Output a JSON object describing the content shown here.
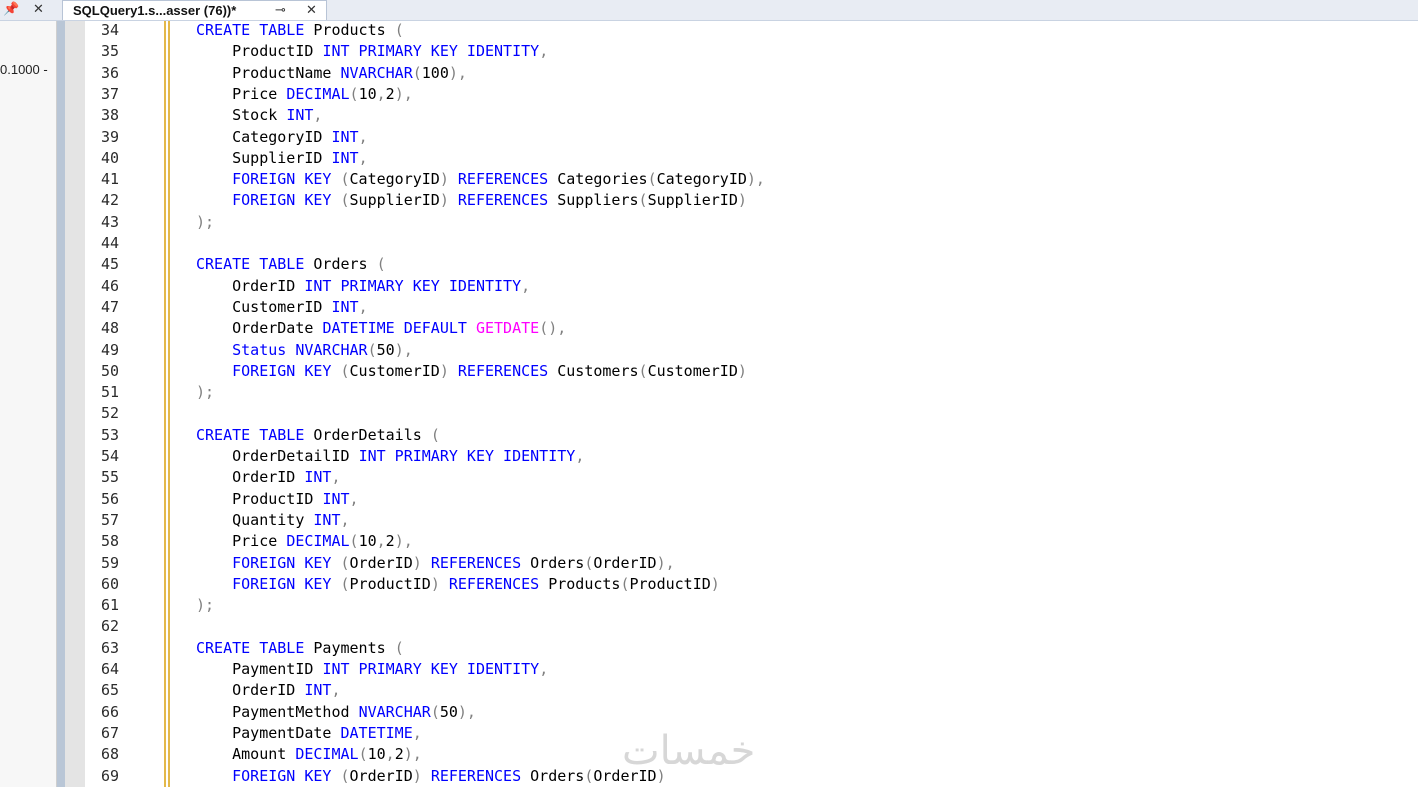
{
  "tab": {
    "title": "SQLQuery1.s...asser (76))*"
  },
  "left_panel": {
    "value": "0.1000 -"
  },
  "watermark": "خمسات",
  "icons": [
    "pin-icon",
    "close-icon",
    "tab-pin-icon",
    "tab-close-icon"
  ],
  "lines": [
    {
      "n": "34",
      "t": [
        [
          "k",
          "CREATE TABLE"
        ],
        [
          "p",
          " Products "
        ],
        [
          "g",
          "("
        ]
      ]
    },
    {
      "n": "35",
      "t": [
        [
          "p",
          "    ProductID "
        ],
        [
          "k",
          "INT PRIMARY KEY IDENTITY"
        ],
        [
          "g",
          ","
        ]
      ]
    },
    {
      "n": "36",
      "t": [
        [
          "p",
          "    ProductName "
        ],
        [
          "k",
          "NVARCHAR"
        ],
        [
          "g",
          "("
        ],
        [
          "p",
          "100"
        ],
        [
          "g",
          "),"
        ]
      ]
    },
    {
      "n": "37",
      "t": [
        [
          "p",
          "    Price "
        ],
        [
          "k",
          "DECIMAL"
        ],
        [
          "g",
          "("
        ],
        [
          "p",
          "10"
        ],
        [
          "g",
          ","
        ],
        [
          "p",
          "2"
        ],
        [
          "g",
          "),"
        ]
      ]
    },
    {
      "n": "38",
      "t": [
        [
          "p",
          "    Stock "
        ],
        [
          "k",
          "INT"
        ],
        [
          "g",
          ","
        ]
      ]
    },
    {
      "n": "39",
      "t": [
        [
          "p",
          "    CategoryID "
        ],
        [
          "k",
          "INT"
        ],
        [
          "g",
          ","
        ]
      ]
    },
    {
      "n": "40",
      "t": [
        [
          "p",
          "    SupplierID "
        ],
        [
          "k",
          "INT"
        ],
        [
          "g",
          ","
        ]
      ]
    },
    {
      "n": "41",
      "t": [
        [
          "p",
          "    "
        ],
        [
          "k",
          "FOREIGN KEY"
        ],
        [
          "p",
          " "
        ],
        [
          "g",
          "("
        ],
        [
          "p",
          "CategoryID"
        ],
        [
          "g",
          ")"
        ],
        [
          "p",
          " "
        ],
        [
          "k",
          "REFERENCES"
        ],
        [
          "p",
          " Categories"
        ],
        [
          "g",
          "("
        ],
        [
          "p",
          "CategoryID"
        ],
        [
          "g",
          "),"
        ]
      ]
    },
    {
      "n": "42",
      "t": [
        [
          "p",
          "    "
        ],
        [
          "k",
          "FOREIGN KEY"
        ],
        [
          "p",
          " "
        ],
        [
          "g",
          "("
        ],
        [
          "p",
          "SupplierID"
        ],
        [
          "g",
          ")"
        ],
        [
          "p",
          " "
        ],
        [
          "k",
          "REFERENCES"
        ],
        [
          "p",
          " Suppliers"
        ],
        [
          "g",
          "("
        ],
        [
          "p",
          "SupplierID"
        ],
        [
          "g",
          ")"
        ]
      ]
    },
    {
      "n": "43",
      "t": [
        [
          "g",
          ");"
        ]
      ]
    },
    {
      "n": "44",
      "t": []
    },
    {
      "n": "45",
      "t": [
        [
          "k",
          "CREATE TABLE"
        ],
        [
          "p",
          " Orders "
        ],
        [
          "g",
          "("
        ]
      ]
    },
    {
      "n": "46",
      "t": [
        [
          "p",
          "    OrderID "
        ],
        [
          "k",
          "INT PRIMARY KEY IDENTITY"
        ],
        [
          "g",
          ","
        ]
      ]
    },
    {
      "n": "47",
      "t": [
        [
          "p",
          "    CustomerID "
        ],
        [
          "k",
          "INT"
        ],
        [
          "g",
          ","
        ]
      ]
    },
    {
      "n": "48",
      "t": [
        [
          "p",
          "    OrderDate "
        ],
        [
          "k",
          "DATETIME DEFAULT"
        ],
        [
          "p",
          " "
        ],
        [
          "f",
          "GETDATE"
        ],
        [
          "g",
          "(),"
        ]
      ]
    },
    {
      "n": "49",
      "t": [
        [
          "p",
          "    "
        ],
        [
          "k",
          "Status NVARCHAR"
        ],
        [
          "g",
          "("
        ],
        [
          "p",
          "50"
        ],
        [
          "g",
          "),"
        ]
      ]
    },
    {
      "n": "50",
      "t": [
        [
          "p",
          "    "
        ],
        [
          "k",
          "FOREIGN KEY"
        ],
        [
          "p",
          " "
        ],
        [
          "g",
          "("
        ],
        [
          "p",
          "CustomerID"
        ],
        [
          "g",
          ")"
        ],
        [
          "p",
          " "
        ],
        [
          "k",
          "REFERENCES"
        ],
        [
          "p",
          " Customers"
        ],
        [
          "g",
          "("
        ],
        [
          "p",
          "CustomerID"
        ],
        [
          "g",
          ")"
        ]
      ]
    },
    {
      "n": "51",
      "t": [
        [
          "g",
          ");"
        ]
      ]
    },
    {
      "n": "52",
      "t": []
    },
    {
      "n": "53",
      "t": [
        [
          "k",
          "CREATE TABLE"
        ],
        [
          "p",
          " OrderDetails "
        ],
        [
          "g",
          "("
        ]
      ]
    },
    {
      "n": "54",
      "t": [
        [
          "p",
          "    OrderDetailID "
        ],
        [
          "k",
          "INT PRIMARY KEY IDENTITY"
        ],
        [
          "g",
          ","
        ]
      ]
    },
    {
      "n": "55",
      "t": [
        [
          "p",
          "    OrderID "
        ],
        [
          "k",
          "INT"
        ],
        [
          "g",
          ","
        ]
      ]
    },
    {
      "n": "56",
      "t": [
        [
          "p",
          "    ProductID "
        ],
        [
          "k",
          "INT"
        ],
        [
          "g",
          ","
        ]
      ]
    },
    {
      "n": "57",
      "t": [
        [
          "p",
          "    Quantity "
        ],
        [
          "k",
          "INT"
        ],
        [
          "g",
          ","
        ]
      ]
    },
    {
      "n": "58",
      "t": [
        [
          "p",
          "    Price "
        ],
        [
          "k",
          "DECIMAL"
        ],
        [
          "g",
          "("
        ],
        [
          "p",
          "10"
        ],
        [
          "g",
          ","
        ],
        [
          "p",
          "2"
        ],
        [
          "g",
          "),"
        ]
      ]
    },
    {
      "n": "59",
      "t": [
        [
          "p",
          "    "
        ],
        [
          "k",
          "FOREIGN KEY"
        ],
        [
          "p",
          " "
        ],
        [
          "g",
          "("
        ],
        [
          "p",
          "OrderID"
        ],
        [
          "g",
          ")"
        ],
        [
          "p",
          " "
        ],
        [
          "k",
          "REFERENCES"
        ],
        [
          "p",
          " Orders"
        ],
        [
          "g",
          "("
        ],
        [
          "p",
          "OrderID"
        ],
        [
          "g",
          "),"
        ]
      ]
    },
    {
      "n": "60",
      "t": [
        [
          "p",
          "    "
        ],
        [
          "k",
          "FOREIGN KEY"
        ],
        [
          "p",
          " "
        ],
        [
          "g",
          "("
        ],
        [
          "p",
          "ProductID"
        ],
        [
          "g",
          ")"
        ],
        [
          "p",
          " "
        ],
        [
          "k",
          "REFERENCES"
        ],
        [
          "p",
          " Products"
        ],
        [
          "g",
          "("
        ],
        [
          "p",
          "ProductID"
        ],
        [
          "g",
          ")"
        ]
      ]
    },
    {
      "n": "61",
      "t": [
        [
          "g",
          ");"
        ]
      ]
    },
    {
      "n": "62",
      "t": []
    },
    {
      "n": "63",
      "t": [
        [
          "k",
          "CREATE TABLE"
        ],
        [
          "p",
          " Payments "
        ],
        [
          "g",
          "("
        ]
      ]
    },
    {
      "n": "64",
      "t": [
        [
          "p",
          "    PaymentID "
        ],
        [
          "k",
          "INT PRIMARY KEY IDENTITY"
        ],
        [
          "g",
          ","
        ]
      ]
    },
    {
      "n": "65",
      "t": [
        [
          "p",
          "    OrderID "
        ],
        [
          "k",
          "INT"
        ],
        [
          "g",
          ","
        ]
      ]
    },
    {
      "n": "66",
      "t": [
        [
          "p",
          "    PaymentMethod "
        ],
        [
          "k",
          "NVARCHAR"
        ],
        [
          "g",
          "("
        ],
        [
          "p",
          "50"
        ],
        [
          "g",
          "),"
        ]
      ]
    },
    {
      "n": "67",
      "t": [
        [
          "p",
          "    PaymentDate "
        ],
        [
          "k",
          "DATETIME"
        ],
        [
          "g",
          ","
        ]
      ]
    },
    {
      "n": "68",
      "t": [
        [
          "p",
          "    Amount "
        ],
        [
          "k",
          "DECIMAL"
        ],
        [
          "g",
          "("
        ],
        [
          "p",
          "10"
        ],
        [
          "g",
          ","
        ],
        [
          "p",
          "2"
        ],
        [
          "g",
          "),"
        ]
      ]
    },
    {
      "n": "69",
      "t": [
        [
          "p",
          "    "
        ],
        [
          "k",
          "FOREIGN KEY"
        ],
        [
          "p",
          " "
        ],
        [
          "g",
          "("
        ],
        [
          "p",
          "OrderID"
        ],
        [
          "g",
          ")"
        ],
        [
          "p",
          " "
        ],
        [
          "k",
          "REFERENCES"
        ],
        [
          "p",
          " Orders"
        ],
        [
          "g",
          "("
        ],
        [
          "p",
          "OrderID"
        ],
        [
          "g",
          ")"
        ]
      ]
    }
  ]
}
